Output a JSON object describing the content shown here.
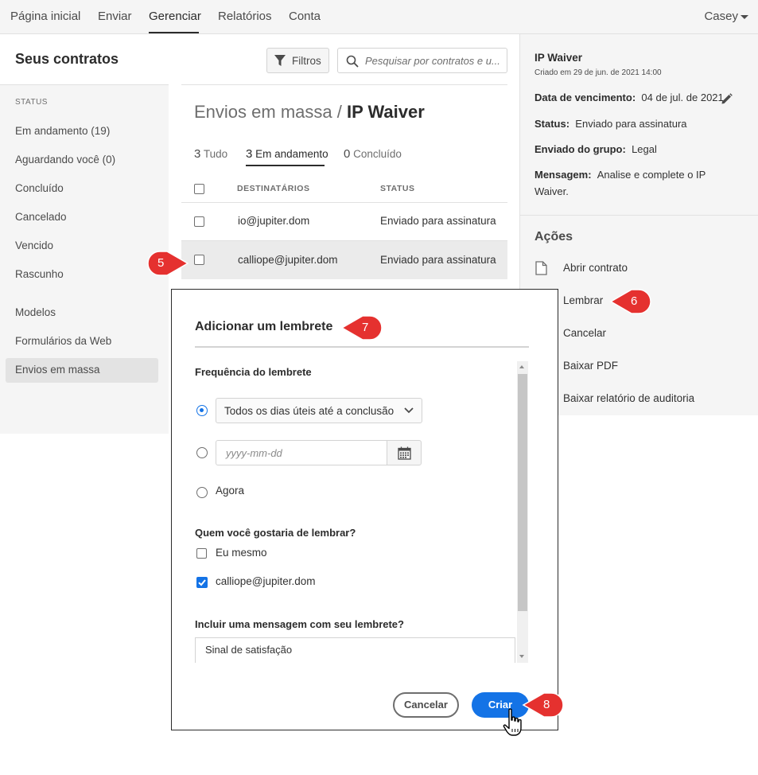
{
  "topnav": {
    "items": [
      "Página inicial",
      "Enviar",
      "Gerenciar",
      "Relatórios",
      "Conta"
    ],
    "active": "Gerenciar",
    "user": "Casey"
  },
  "sidebar": {
    "title": "Seus contratos",
    "status_label": "STATUS",
    "status_items": [
      "Em andamento (19)",
      "Aguardando você (0)",
      "Concluído",
      "Cancelado",
      "Vencido",
      "Rascunho"
    ],
    "other_items": [
      "Modelos",
      "Formulários da Web",
      "Envios em massa"
    ],
    "active_item": "Envios em massa"
  },
  "toolbar": {
    "filter_label": "Filtros",
    "search_placeholder": "Pesquisar por contratos e u..."
  },
  "main": {
    "breadcrumb_parent": "Envios em massa /",
    "breadcrumb_current": "IP Waiver",
    "tabs": [
      {
        "count": "3",
        "label": "Tudo"
      },
      {
        "count": "3",
        "label": "Em andamento"
      },
      {
        "count": "0",
        "label": "Concluído"
      }
    ],
    "active_tab": "Em andamento",
    "columns": [
      "DESTINATÁRIOS",
      "STATUS"
    ],
    "rows": [
      {
        "recipient": "io@jupiter.dom",
        "status": "Enviado para assinatura"
      },
      {
        "recipient": "calliope@jupiter.dom",
        "status": "Enviado para assinatura"
      }
    ]
  },
  "details": {
    "title": "IP Waiver",
    "created": "Criado em 29 de jun. de 2021 14:00",
    "due_label": "Data de vencimento:",
    "due_value": "04 de jul. de 2021",
    "status_label": "Status:",
    "status_value": "Enviado para assinatura",
    "group_label": "Enviado do grupo:",
    "group_value": "Legal",
    "message_label": "Mensagem:",
    "message_value_1": "Analise e complete o IP",
    "message_value_2": "Waiver.",
    "actions_heading": "Ações",
    "actions": [
      "Abrir contrato",
      "Lembrar",
      "Cancelar",
      "Baixar PDF",
      "Baixar relatório de auditoria"
    ]
  },
  "modal": {
    "title": "Adicionar um lembrete",
    "frequency_label": "Frequência do lembrete",
    "frequency_option": "Todos os dias úteis até a conclusão",
    "date_placeholder": "yyyy-mm-dd",
    "now_label": "Agora",
    "who_label": "Quem você gostaria de lembrar?",
    "recipients": [
      {
        "label": "Eu mesmo",
        "checked": false
      },
      {
        "label": "calliope@jupiter.dom",
        "checked": true
      }
    ],
    "message_label": "Incluir uma mensagem com seu lembrete?",
    "message_value": "Sinal de satisfação",
    "cancel_label": "Cancelar",
    "create_label": "Criar"
  },
  "callouts": [
    "5",
    "6",
    "7",
    "8"
  ],
  "colors": {
    "accent": "#1473e6",
    "callout": "#e5312f",
    "panel_bg": "#f5f5f5"
  }
}
